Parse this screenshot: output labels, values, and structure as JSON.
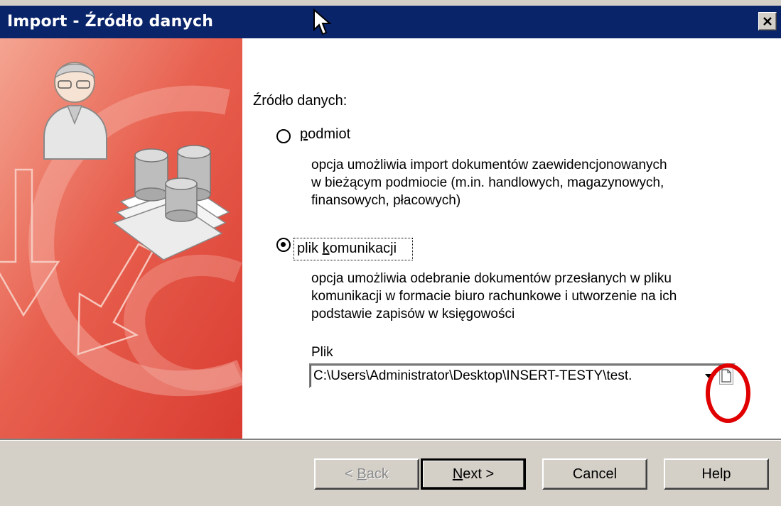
{
  "window": {
    "title": "Import - Źródło danych"
  },
  "heading": "Źródło danych:",
  "options": [
    {
      "label_accel": "p",
      "label_rest": "odmiot",
      "selected": false,
      "description": [
        "opcja umożliwia import dokumentów zaewidencjonowanych",
        "w bieżącym podmiocie (m.in. handlowych, magazynowych,",
        "finansowych, płacowych)"
      ]
    },
    {
      "label_pre": "plik ",
      "label_accel": "k",
      "label_rest": "omunikacji",
      "selected": true,
      "description": [
        "opcja umożliwia odebranie dokumentów przesłanych w pliku",
        "komunikacji w formacie biuro rachunkowe i utworzenie na ich",
        "podstawie zapisów w księgowości"
      ]
    }
  ],
  "file": {
    "label": "Plik",
    "value": "C:\\Users\\Administrator\\Desktop\\INSERT-TESTY\\test."
  },
  "buttons": {
    "back_pre": "< ",
    "back_accel": "B",
    "back_rest": "ack",
    "next_accel": "N",
    "next_rest": "ext >",
    "cancel": "Cancel",
    "help": "Help"
  },
  "colors": {
    "titlebar": "#0a246a",
    "side_panel": "#e2574a",
    "highlight": "#e00000"
  },
  "icons": [
    "close-icon",
    "mouse-cursor-icon",
    "user-icon",
    "database-icon",
    "arrow-down-icon",
    "dropdown-arrow-icon",
    "file-icon"
  ]
}
